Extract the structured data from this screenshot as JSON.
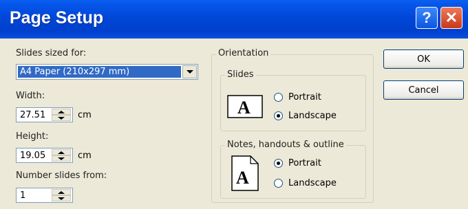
{
  "window": {
    "title": "Page Setup",
    "help_glyph": "?",
    "close_glyph": "✕"
  },
  "left": {
    "slides_sized_for_label": "Slides sized for:",
    "slides_sized_for_value": "A4 Paper (210x297 mm)",
    "width_label": "Width:",
    "width_value": "27.51",
    "width_unit": "cm",
    "height_label": "Height:",
    "height_value": "19.05",
    "height_unit": "cm",
    "number_slides_label": "Number slides from:",
    "number_slides_value": "1"
  },
  "orientation": {
    "title": "Orientation",
    "slides": {
      "title": "Slides",
      "portrait": "Portrait",
      "landscape": "Landscape",
      "selected": "Landscape"
    },
    "notes": {
      "title": "Notes, handouts & outline",
      "portrait": "Portrait",
      "landscape": "Landscape",
      "selected": "Portrait"
    }
  },
  "buttons": {
    "ok": "OK",
    "cancel": "Cancel"
  },
  "colors": {
    "titlebar": "#0047d8",
    "dialog_bg": "#ece9d8",
    "selection": "#316ac5"
  },
  "icons": {
    "slides_page": "page-landscape-icon",
    "notes_page": "page-portrait-icon"
  }
}
